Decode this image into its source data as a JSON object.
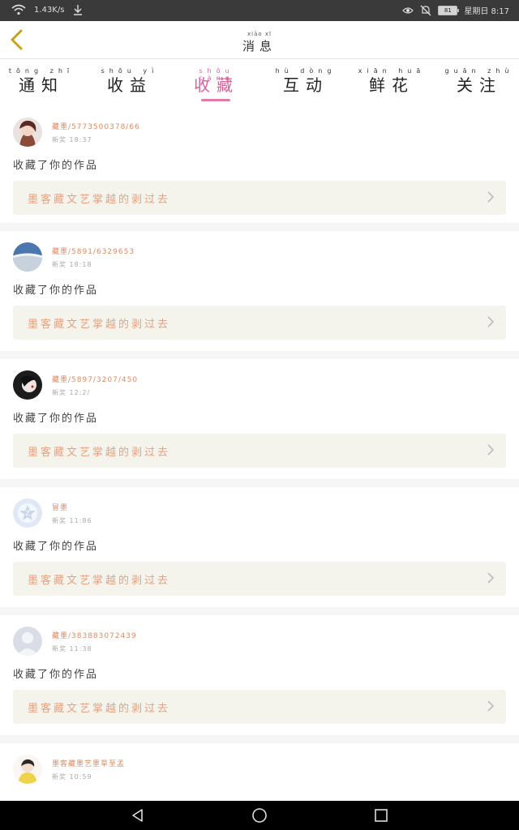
{
  "status": {
    "speed": "1.43K/s",
    "battery": "81",
    "time": "星期日 8:17"
  },
  "header": {
    "title_pinyin": "xiāo xī",
    "title": "消息"
  },
  "tabs": [
    {
      "py": "tōng zhī",
      "label": "通知"
    },
    {
      "py": "shōu yì",
      "label": "收益"
    },
    {
      "py": "shōu cáng",
      "label": "收藏"
    },
    {
      "py": "hù dòng",
      "label": "互动"
    },
    {
      "py": "xiān huā",
      "label": "鲜花"
    },
    {
      "py": "guān zhù",
      "label": "关注"
    }
  ],
  "items": [
    {
      "user": "藏墨/5773500378/66",
      "meta": "新奖 18:37",
      "action": "收藏了你的作品",
      "work": "墨客藏文艺掌越的剥过去"
    },
    {
      "user": "藏墨/5891/6329653",
      "meta": "新奖 18:18",
      "action": "收藏了你的作品",
      "work": "墨客藏文艺掌越的剥过去"
    },
    {
      "user": "藏墨/5897/3207/450",
      "meta": "新奖 12:2/",
      "action": "收藏了你的作品",
      "work": "墨客藏文艺掌越的剥过去"
    },
    {
      "user": "冒墨",
      "meta": "新奖 11:86",
      "action": "收藏了你的作品",
      "work": "墨客藏文艺掌越的剥过去"
    },
    {
      "user": "藏墨/383883072439",
      "meta": "新奖 11:38",
      "action": "收藏了你的作品",
      "work": "墨客藏文艺掌越的剥过去"
    },
    {
      "user": "墨客藏墨艺墨草至孟",
      "meta": "新奖 10:59",
      "action": "",
      "work": ""
    }
  ],
  "colors": {
    "accent": "#d9619b",
    "username": "#e08a61",
    "work_bg": "#f5f4ec"
  }
}
